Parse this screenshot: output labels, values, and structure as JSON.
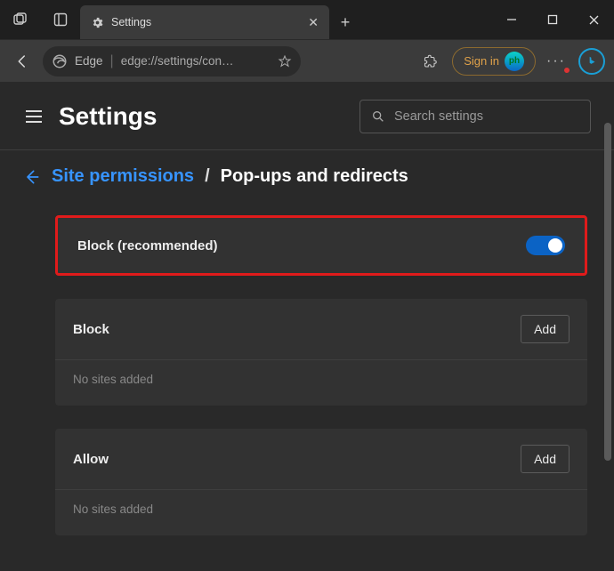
{
  "tab": {
    "title": "Settings"
  },
  "toolbar": {
    "edge_label": "Edge",
    "url": "edge://settings/con…",
    "signin": "Sign in"
  },
  "header": {
    "title": "Settings",
    "search_placeholder": "Search settings"
  },
  "breadcrumb": {
    "parent": "Site permissions",
    "separator": "/",
    "current": "Pop-ups and redirects"
  },
  "main_toggle": {
    "label": "Block (recommended)",
    "on": true
  },
  "sections": {
    "block": {
      "title": "Block",
      "add": "Add",
      "empty": "No sites added"
    },
    "allow": {
      "title": "Allow",
      "add": "Add",
      "empty": "No sites added"
    }
  }
}
